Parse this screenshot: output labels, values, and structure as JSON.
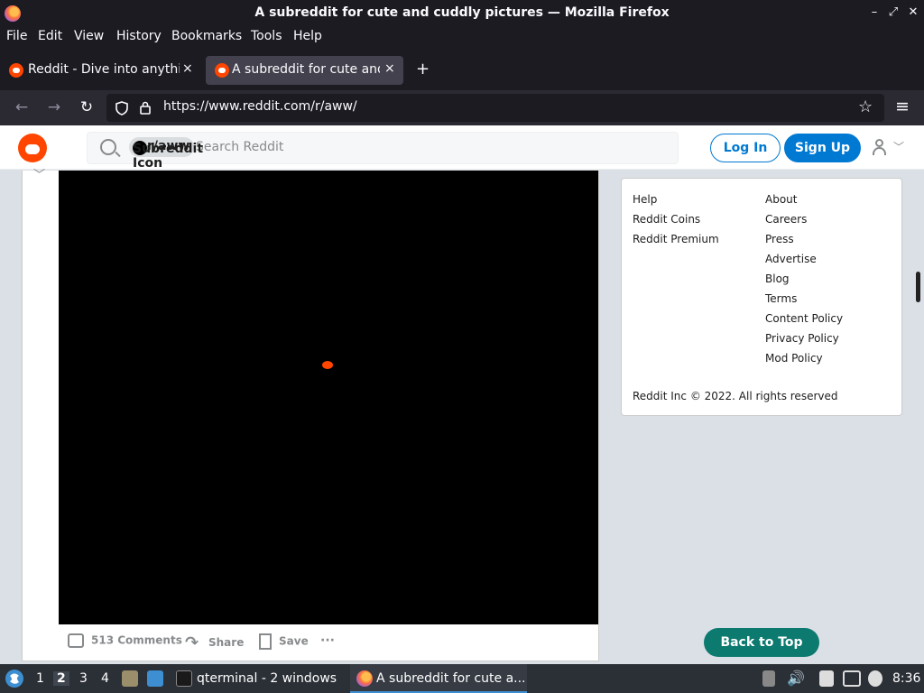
{
  "window": {
    "title": "A subreddit for cute and cuddly pictures — Mozilla Firefox",
    "min_glyph": "–",
    "restore_glyph": "⤢",
    "close_glyph": "✕"
  },
  "menu": [
    "File",
    "Edit",
    "View",
    "History",
    "Bookmarks",
    "Tools",
    "Help"
  ],
  "tabs": [
    {
      "label": "Reddit - Dive into anythin",
      "active": false
    },
    {
      "label": "A subreddit for cute and",
      "active": true
    }
  ],
  "tab_close_glyph": "×",
  "new_tab_glyph": "+",
  "nav": {
    "back_glyph": "←",
    "forward_glyph": "→",
    "reload_glyph": "↻",
    "url": "https://www.reddit.com/r/aww/",
    "bookmark_glyph": "☆",
    "menu_glyph": "≡"
  },
  "reddit": {
    "search_chip": "r/aww",
    "search_chip_alt": "Subreddit Icon",
    "search_placeholder": "Search Reddit",
    "login_label": "Log In",
    "signup_label": "Sign Up",
    "user_chevron": "﹀",
    "downvote_glyph": "﹀",
    "actions": {
      "comments": "513 Comments",
      "share": "Share",
      "save": "Save",
      "more": "···"
    },
    "sidebar_left": [
      "Help",
      "Reddit Coins",
      "Reddit Premium"
    ],
    "sidebar_right": [
      "About",
      "Careers",
      "Press",
      "Advertise",
      "Blog",
      "Terms",
      "Content Policy",
      "Privacy Policy",
      "Mod Policy"
    ],
    "copyright": "Reddit Inc © 2022. All rights reserved",
    "back_to_top": "Back to Top"
  },
  "taskbar": {
    "workspaces": [
      "1",
      "2",
      "3",
      "4"
    ],
    "active_workspace": "2",
    "terminal_label": "qterminal - 2 windows",
    "firefox_label": "A subreddit for cute a...",
    "clock": "8:36"
  },
  "colors": {
    "reddit_orange": "#ff4500",
    "reddit_blue": "#0079d3",
    "back_to_top": "#0d7a70"
  }
}
